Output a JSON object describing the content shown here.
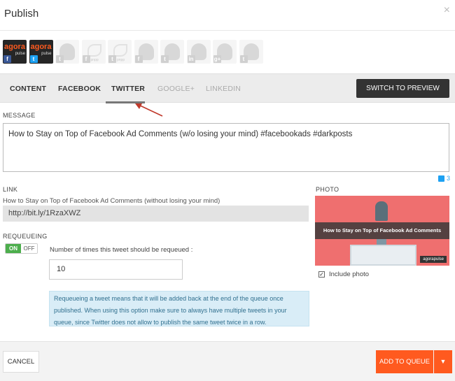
{
  "header": {
    "title": "Publish",
    "close_glyph": "×"
  },
  "profiles": [
    {
      "kind": "brand",
      "logo": "agora",
      "sub": "pulse",
      "network": "f",
      "network_icon": "facebook-icon"
    },
    {
      "kind": "brand",
      "logo": "agora",
      "sub": "pulse",
      "network": "t",
      "network_icon": "twitter-icon"
    },
    {
      "kind": "person",
      "network": "t",
      "network_icon": "twitter-icon"
    },
    {
      "kind": "leaf",
      "network": "f",
      "network_icon": "facebook-icon",
      "tag": "pnpp"
    },
    {
      "kind": "leaf",
      "network": "t",
      "network_icon": "twitter-icon",
      "tag": "pnpp"
    },
    {
      "kind": "person",
      "network": "f",
      "network_icon": "facebook-icon"
    },
    {
      "kind": "person",
      "network": "t",
      "network_icon": "twitter-icon"
    },
    {
      "kind": "person",
      "network": "in",
      "network_icon": "linkedin-icon"
    },
    {
      "kind": "person",
      "network": "g+",
      "network_icon": "google-plus-icon"
    },
    {
      "kind": "person",
      "network": "t",
      "network_icon": "twitter-icon"
    }
  ],
  "tabs": [
    {
      "label": "CONTENT",
      "active": false,
      "enabled": true
    },
    {
      "label": "FACEBOOK",
      "active": false,
      "enabled": true
    },
    {
      "label": "TWITTER",
      "active": true,
      "enabled": true
    },
    {
      "label": "GOOGLE+",
      "active": false,
      "enabled": false
    },
    {
      "label": "LINKEDIN",
      "active": false,
      "enabled": false
    }
  ],
  "preview_button": "SWITCH TO PREVIEW MODE",
  "message": {
    "label": "MESSAGE",
    "value": "How to Stay on Top of Facebook Ad Comments (w/o losing your mind) #facebookads #darkposts",
    "tweet_count": "3"
  },
  "link": {
    "label": "LINK",
    "title": "How to Stay on Top of Facebook Ad Comments (without losing your mind)",
    "url": "http://bit.ly/1RzaXWZ"
  },
  "requeue": {
    "label": "REQUEUEING",
    "on": "ON",
    "off": "OFF",
    "question": "Number of times this tweet should be requeued :",
    "value": "10",
    "info": "Requeueing a tweet means that it will be added back at the end of the queue once published. When using this option make sure to always have multiple tweets in your queue, since Twitter does not allow to publish the same tweet twice in a row."
  },
  "photo": {
    "label": "PHOTO",
    "caption": "How to Stay on Top of Facebook Ad Comments",
    "brand": "agorapulse",
    "include_label": "Include photo",
    "include_checked": true
  },
  "footer": {
    "cancel": "CANCEL",
    "add": "ADD TO QUEUE",
    "caret": "▼"
  },
  "colors": {
    "accent": "#ff5a1f",
    "twitter": "#1da1f2",
    "facebook": "#3b5998",
    "toggle_on": "#4cae4c",
    "arrow": "#c0392b"
  }
}
